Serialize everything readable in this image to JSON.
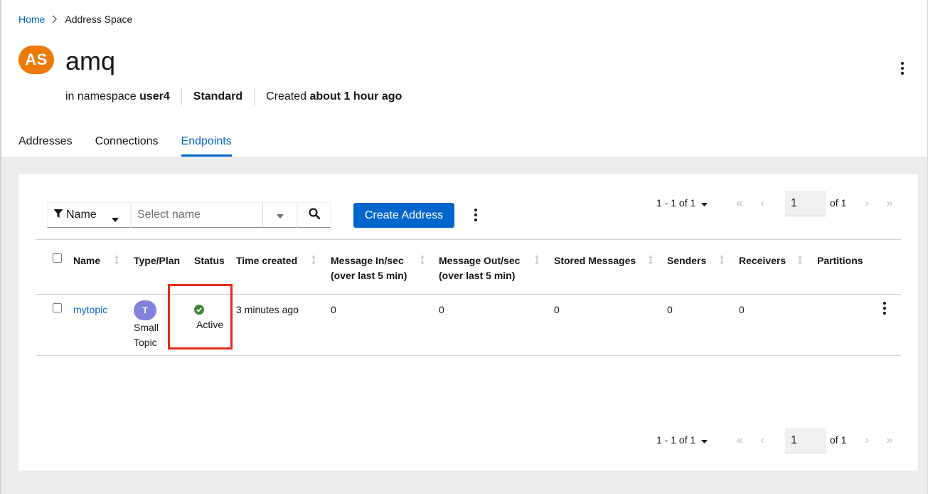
{
  "breadcrumb": {
    "home": "Home",
    "current": "Address Space"
  },
  "header": {
    "avatar": "AS",
    "title": "amq",
    "namespace_prefix": "in namespace",
    "namespace": "user4",
    "type": "Standard",
    "created_prefix": "Created",
    "created": "about 1 hour ago"
  },
  "tabs": [
    {
      "label": "Addresses",
      "active": false
    },
    {
      "label": "Connections",
      "active": false
    },
    {
      "label": "Endpoints",
      "active": true
    }
  ],
  "toolbar": {
    "filter_label": "Name",
    "search_placeholder": "Select name",
    "create_label": "Create Address"
  },
  "pagination": {
    "range": "1 - 1 of 1",
    "page": "1",
    "of_total": "of 1"
  },
  "table": {
    "columns": [
      "Name",
      "Type/Plan",
      "Status",
      "Time created",
      "Message In/sec",
      "(over last 5 min)",
      "Message Out/sec",
      "(over last 5 min)",
      "Stored Messages",
      "Senders",
      "Receivers",
      "Partitions"
    ],
    "rows": [
      {
        "name": "mytopic",
        "type_avatar": "T",
        "plan_line1": "Small",
        "plan_line2": "Topic",
        "status": "Active",
        "time_created": "3 minutes ago",
        "message_in": "0",
        "message_out": "0",
        "stored": "0",
        "senders": "0",
        "receivers": "0",
        "partitions": ""
      }
    ]
  },
  "colors": {
    "accent": "#0066cc",
    "avatar_as": "#ec7a08",
    "avatar_t": "#8481dd",
    "status_ok": "#3e8635",
    "highlight": "#e8281c"
  },
  "icons": {
    "filter": "filter-icon",
    "search": "search-icon",
    "status": "check-circle-icon"
  }
}
